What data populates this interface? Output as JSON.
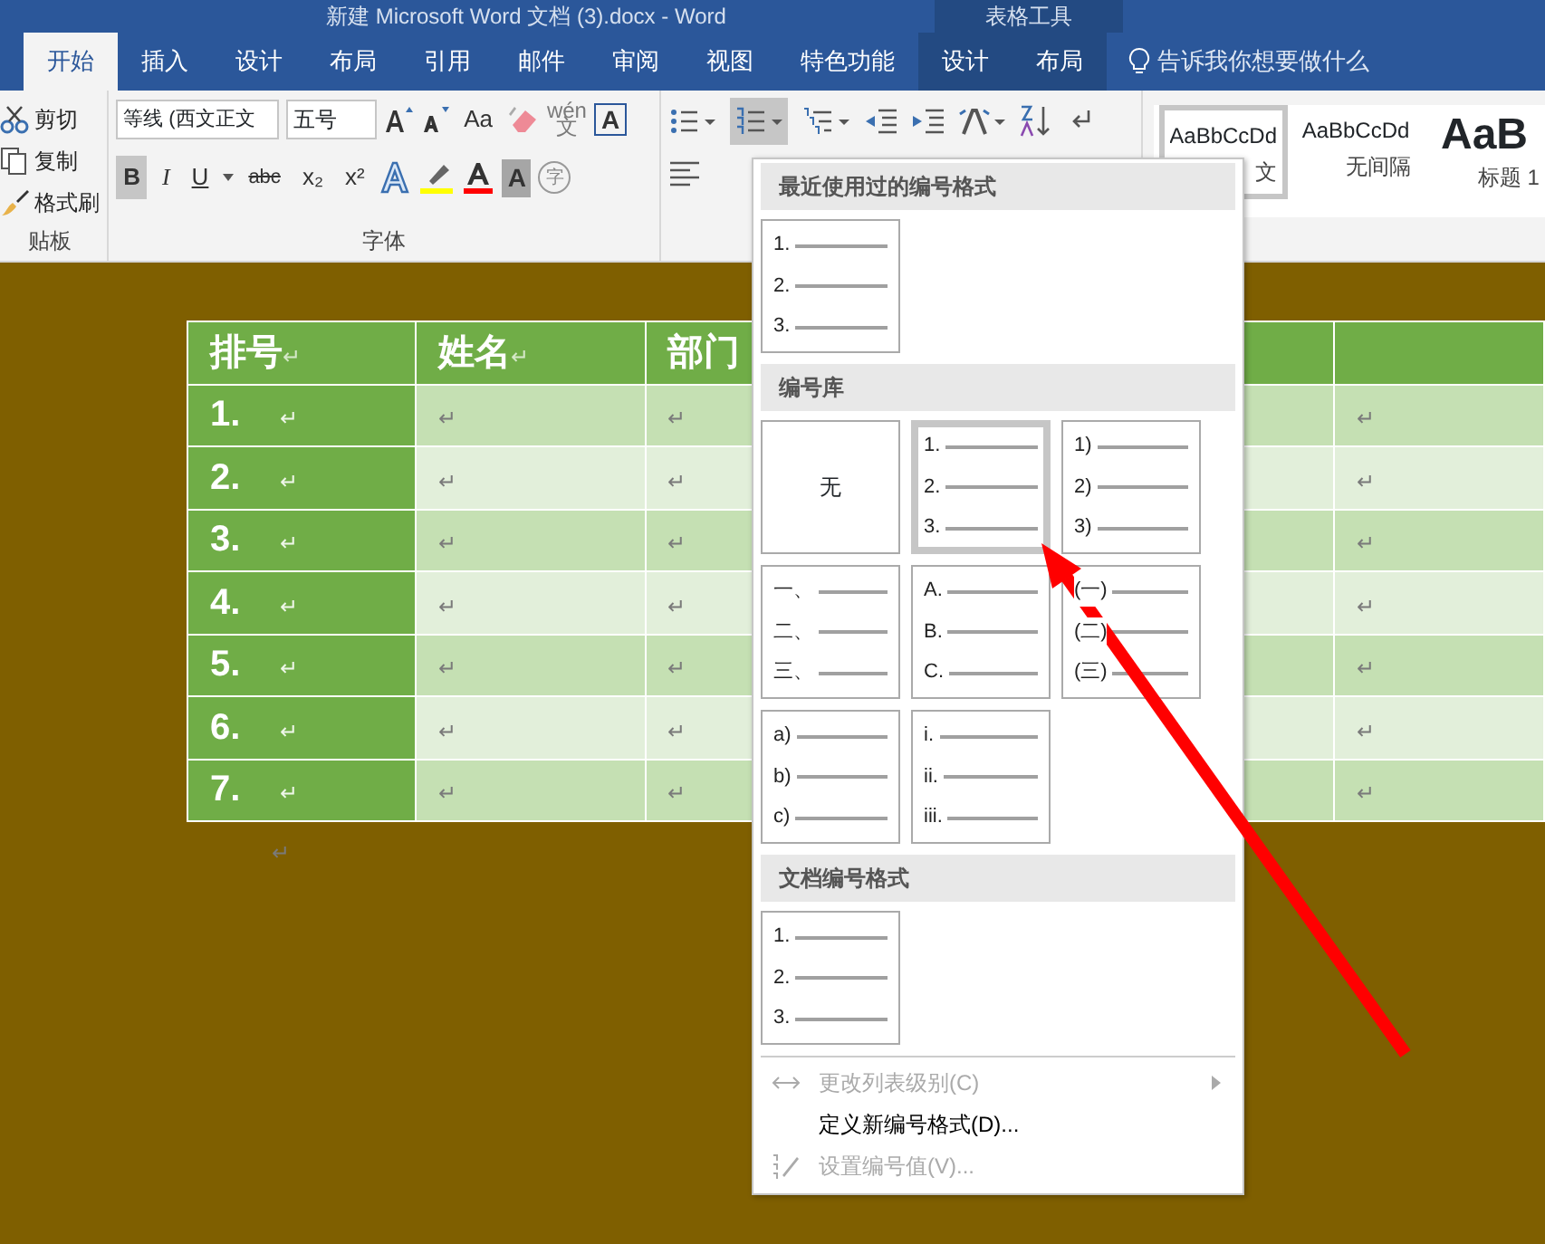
{
  "title_bar": {
    "title": "新建 Microsoft Word 文档 (3).docx - Word",
    "context_label": "表格工具"
  },
  "tabs": [
    {
      "label": "开始",
      "selected": true,
      "kind": "main"
    },
    {
      "label": "插入",
      "selected": false,
      "kind": "main"
    },
    {
      "label": "设计",
      "selected": false,
      "kind": "main"
    },
    {
      "label": "布局",
      "selected": false,
      "kind": "main"
    },
    {
      "label": "引用",
      "selected": false,
      "kind": "main"
    },
    {
      "label": "邮件",
      "selected": false,
      "kind": "main"
    },
    {
      "label": "审阅",
      "selected": false,
      "kind": "main"
    },
    {
      "label": "视图",
      "selected": false,
      "kind": "main"
    },
    {
      "label": "特色功能",
      "selected": false,
      "kind": "main"
    },
    {
      "label": "设计",
      "selected": false,
      "kind": "context"
    },
    {
      "label": "布局",
      "selected": false,
      "kind": "context"
    }
  ],
  "tell_me": "告诉我你想要做什么",
  "clipboard": {
    "items": [
      "剪切",
      "复制",
      "格式刷"
    ],
    "group_label": "贴板"
  },
  "font": {
    "name": "等线 (西文正文",
    "size": "五号",
    "change_case": "Aa",
    "phonetic": "wén",
    "phonetic_char": "文",
    "boxed": "A",
    "bold": "B",
    "italic": "I",
    "underline": "U",
    "strike": "abc",
    "sub": "x₂",
    "sup": "x²",
    "shading": "A",
    "enclose": "字",
    "group_label": "字体"
  },
  "styles": [
    {
      "preview": "AaBbCcDd",
      "label": "文",
      "selected": true
    },
    {
      "preview": "AaBbCcDd",
      "label": "无间隔",
      "selected": false
    },
    {
      "preview": "AaB",
      "label": "标题 1",
      "selected": false
    }
  ],
  "table": {
    "header": [
      {
        "text": "排号",
        "mark": "↵"
      },
      {
        "text": "姓名",
        "mark": "↵"
      },
      {
        "text": "部门"
      }
    ],
    "rows": [
      {
        "number": "1.",
        "marks": [
          "↵",
          "↵",
          "↵",
          "↵"
        ]
      },
      {
        "number": "2.",
        "marks": [
          "↵",
          "↵",
          "↵",
          "↵"
        ]
      },
      {
        "number": "3.",
        "marks": [
          "↵",
          "↵",
          "↵",
          "↵"
        ]
      },
      {
        "number": "4.",
        "marks": [
          "↵",
          "↵",
          "↵",
          "↵"
        ]
      },
      {
        "number": "5.",
        "marks": [
          "↵",
          "↵",
          "↵",
          "↵"
        ]
      },
      {
        "number": "6.",
        "marks": [
          "↵",
          "↵",
          "↵",
          "↵"
        ]
      },
      {
        "number": "7.",
        "marks": [
          "↵",
          "↵",
          "↵",
          "↵"
        ]
      }
    ],
    "after_mark": "↵"
  },
  "numbering_menu": {
    "sections": [
      {
        "title": "最近使用过的编号格式",
        "tiles": [
          {
            "kind": "list",
            "lines": [
              "1.",
              "2.",
              "3."
            ],
            "selected": false
          }
        ]
      },
      {
        "title": "编号库",
        "tiles": [
          {
            "kind": "none",
            "text": "无",
            "selected": false
          },
          {
            "kind": "list",
            "lines": [
              "1.",
              "2.",
              "3."
            ],
            "selected": true
          },
          {
            "kind": "list",
            "lines": [
              "1)",
              "2)",
              "3)"
            ],
            "selected": false
          },
          {
            "kind": "list",
            "lines": [
              "一、",
              "二、",
              "三、"
            ],
            "selected": false
          },
          {
            "kind": "list",
            "lines": [
              "A.",
              "B.",
              "C."
            ],
            "selected": false
          },
          {
            "kind": "list",
            "lines": [
              "(一)",
              "(二)",
              "(三)"
            ],
            "selected": false
          },
          {
            "kind": "list",
            "lines": [
              "a)",
              "b)",
              "c)"
            ],
            "selected": false
          },
          {
            "kind": "list",
            "lines": [
              "i.",
              "ii.",
              "iii."
            ],
            "selected": false
          }
        ]
      },
      {
        "title": "文档编号格式",
        "tiles": [
          {
            "kind": "list",
            "lines": [
              "1.",
              "2.",
              "3."
            ],
            "selected": false
          }
        ]
      }
    ],
    "items": [
      {
        "label": "更改列表级别(C)",
        "disabled": true,
        "kind": "level"
      },
      {
        "label": "定义新编号格式(D)...",
        "disabled": false,
        "kind": "define"
      },
      {
        "label": "设置编号值(V)...",
        "disabled": true,
        "kind": "value"
      }
    ]
  }
}
